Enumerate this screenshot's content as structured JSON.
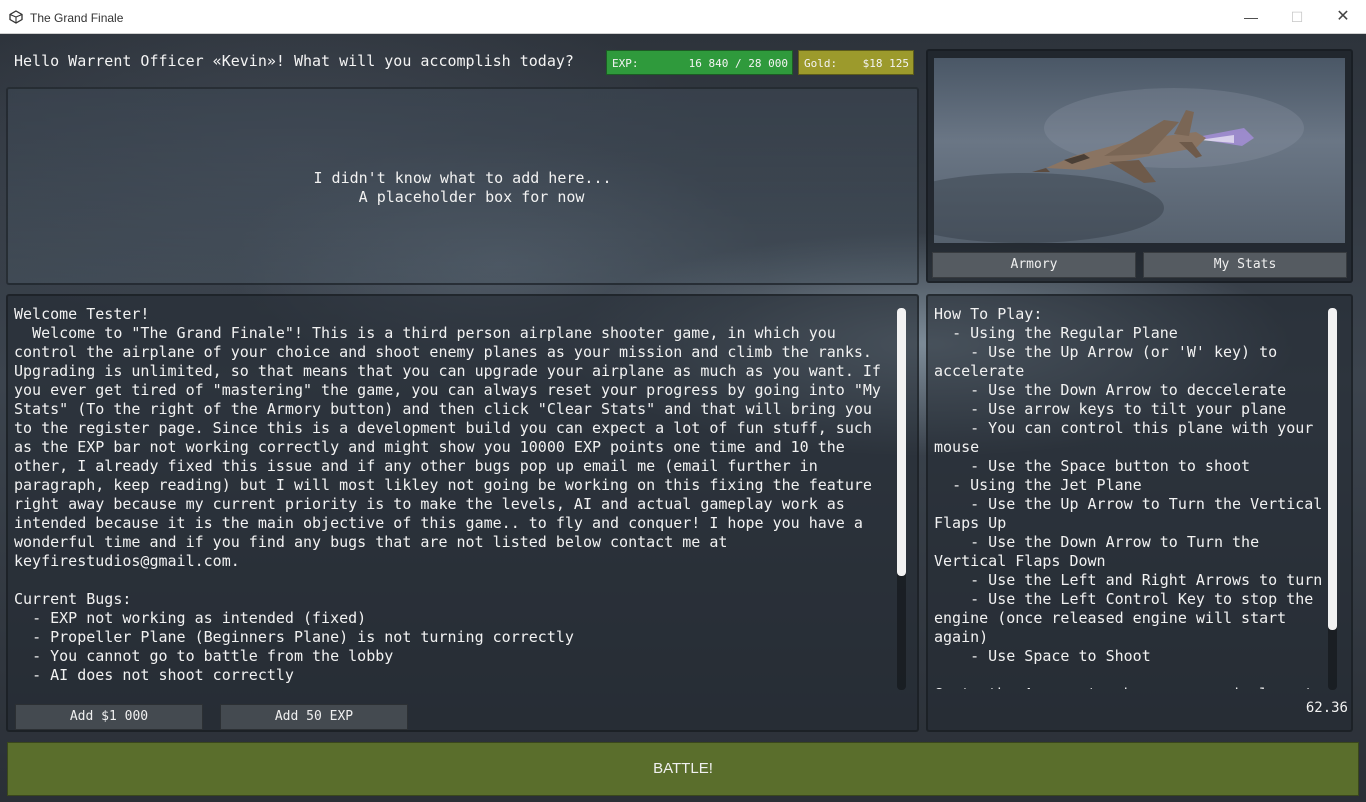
{
  "window": {
    "title": "The Grand Finale",
    "icon": "unity-logo-icon",
    "controls": {
      "minimize": "—",
      "maximize": "☐",
      "close": "✕"
    }
  },
  "header": {
    "greeting": "Hello Warrent Officer «Kevin»! What will you accomplish today?"
  },
  "exp": {
    "label": "EXP:",
    "value": "16 840 / 28 000",
    "color": "#2f9a3c"
  },
  "gold": {
    "label": "Gold:",
    "value": "$18 125",
    "color": "#9c9a2c"
  },
  "placeholder": {
    "text": "I didn't know what to add here...\n  A placeholder box for now"
  },
  "preview": {
    "armory_label": "Armory",
    "stats_label": "My Stats"
  },
  "info": {
    "text": "Welcome Tester!\n  Welcome to \"The Grand Finale\"! This is a third person airplane shooter game, in which you control the airplane of your choice and shoot enemy planes as your mission and climb the ranks. Upgrading is unlimited, so that means that you can upgrade your airplane as much as you want. If you ever get tired of \"mastering\" the game, you can always reset your progress by going into \"My Stats\" (To the right of the Armory button) and then click \"Clear Stats\" and that will bring you to the register page. Since this is a development build you can expect a lot of fun stuff, such as the EXP bar not working correctly and might show you 10000 EXP points one time and 10 the other, I already fixed this issue and if any other bugs pop up email me (email further in paragraph, keep reading) but I will most likley not going be working on this fixing the feature right away because my current priority is to make the levels, AI and actual gameplay work as intended because it is the main objective of this game.. to fly and conquer! I hope you have a wonderful time and if you find any bugs that are not listed below contact me at keyfirestudios@gmail.com.\n\nCurrent Bugs:\n  - EXP not working as intended (fixed)\n  - Propeller Plane (Beginners Plane) is not turning correctly\n  - You cannot go to battle from the lobby\n  - AI does not shoot correctly\n\nIf you are desperate to only find bugs and there is only one way - in battle - fortunately I made",
    "add_money_label": "Add $1 000",
    "add_exp_label": "Add 50 EXP"
  },
  "howto": {
    "text": "How To Play:\n  - Using the Regular Plane\n    - Use the Up Arrow (or 'W' key) to accelerate\n    - Use the Down Arrow to deccelerate\n    - Use arrow keys to tilt your plane\n    - You can control this plane with your mouse\n    - Use the Space button to shoot\n  - Using the Jet Plane\n    - Use the Up Arrow to Turn the Vertical Flaps Up\n    - Use the Down Arrow to Turn the Vertical Flaps Down\n    - Use the Left and Right Arrows to turn\n    - Use the Left Control Key to stop the engine (once released engine will start again)\n    - Use Space to Shoot\n\nGo to the Armory to change your airplane to",
    "fps": "62.36"
  },
  "battle": {
    "label": "BATTLE!",
    "color": "#5a6e2c"
  }
}
